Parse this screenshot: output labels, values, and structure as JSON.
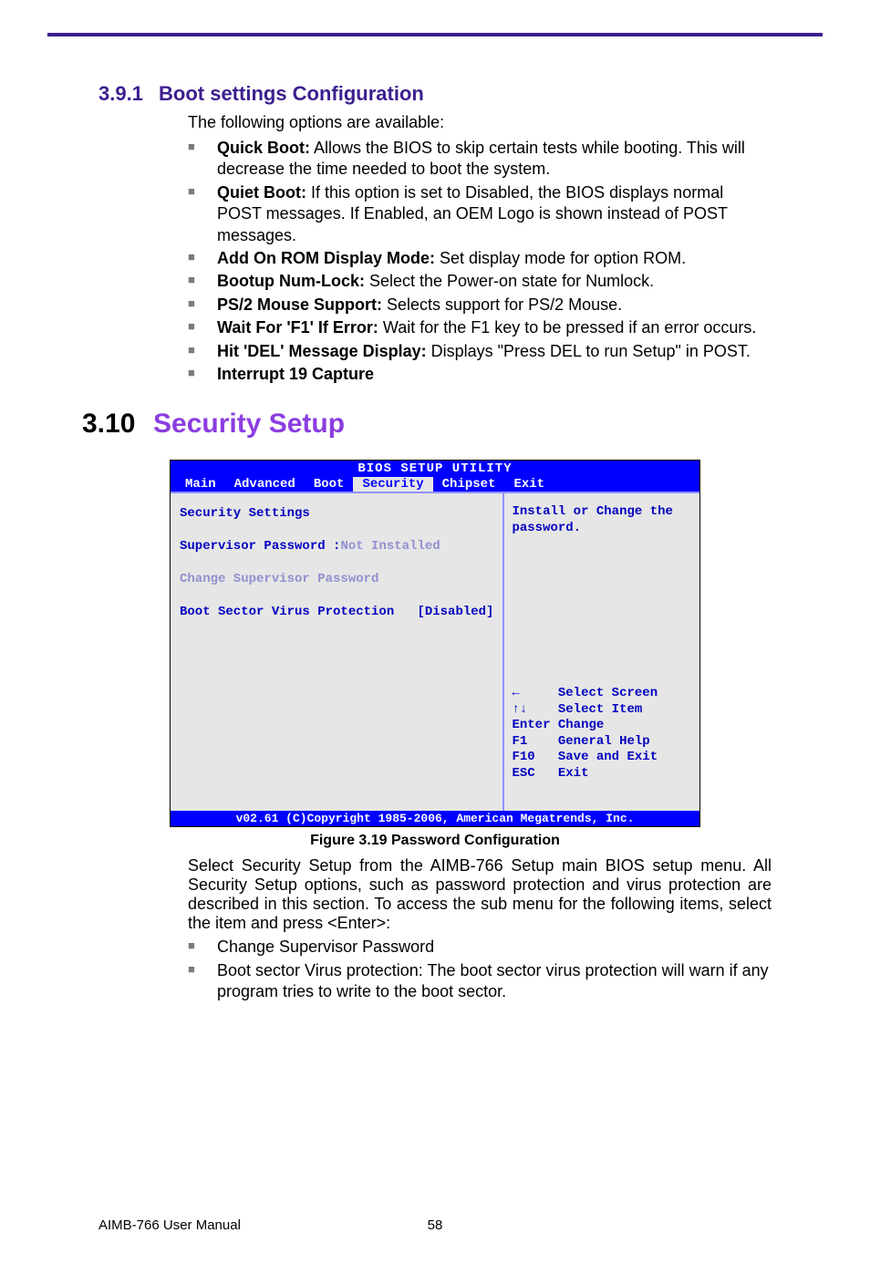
{
  "subsection": {
    "num": "3.9.1",
    "title": "Boot settings Configuration"
  },
  "lead": "The following options are available:",
  "bullets": [
    {
      "label": "Quick Boot:",
      "text": " Allows the BIOS to skip certain tests while booting. This will decrease the time needed to boot the system."
    },
    {
      "label": "Quiet Boot:",
      "text": " If this option is set to Disabled, the BIOS displays normal POST messages. If Enabled, an OEM Logo is shown instead of POST messages."
    },
    {
      "label": "Add On ROM Display Mode:",
      "text": " Set display mode for option ROM."
    },
    {
      "label": "Bootup Num-Lock:",
      "text": " Select the Power-on state for Numlock."
    },
    {
      "label": "PS/2 Mouse Support:",
      "text": " Selects support for PS/2 Mouse."
    },
    {
      "label": "Wait For 'F1' If Error:",
      "text": " Wait for the F1 key to be pressed if an error occurs."
    },
    {
      "label": "Hit 'DEL' Message Display:",
      "text": " Displays \"Press DEL to run Setup\" in POST."
    },
    {
      "label": "Interrupt 19 Capture",
      "text": ""
    }
  ],
  "section": {
    "num": "3.10",
    "title": "Security Setup"
  },
  "bios": {
    "title": "BIOS SETUP UTILITY",
    "tabs": [
      "Main",
      "Advanced",
      "Boot",
      "Security",
      "Chipset",
      "Exit"
    ],
    "selected_tab": "Security",
    "heading": "Security Settings",
    "line1_lbl": "Supervisor Password :",
    "line1_val": "Not Installed",
    "action": "Change Supervisor Password",
    "bvp_lbl": "Boot Sector Virus Protection ",
    "bvp_val": "  [Disabled]",
    "help": "Install or Change the password.",
    "nav": {
      "r1": "←     Select Screen",
      "r2": "↑↓    Select Item",
      "r3": "Enter Change",
      "r4": "F1    General Help",
      "r5": "F10   Save and Exit",
      "r6": "ESC   Exit"
    },
    "footer": "v02.61 (C)Copyright 1985-2006, American Megatrends, Inc."
  },
  "figure_caption": "Figure 3.19 Password Configuration",
  "body_p": "Select Security Setup from the AIMB-766 Setup main BIOS setup menu. All Security Setup options, such as password protection and virus protection are described in this section. To access the sub menu for the following items, select the item and press <Enter>:",
  "body_bullets": [
    {
      "label": "",
      "text": "Change Supervisor Password"
    },
    {
      "label": "",
      "text": "Boot sector Virus protection: The boot sector virus protection will warn if any program tries to write to the boot sector."
    }
  ],
  "footer_left": "AIMB-766 User Manual",
  "footer_page": "58"
}
